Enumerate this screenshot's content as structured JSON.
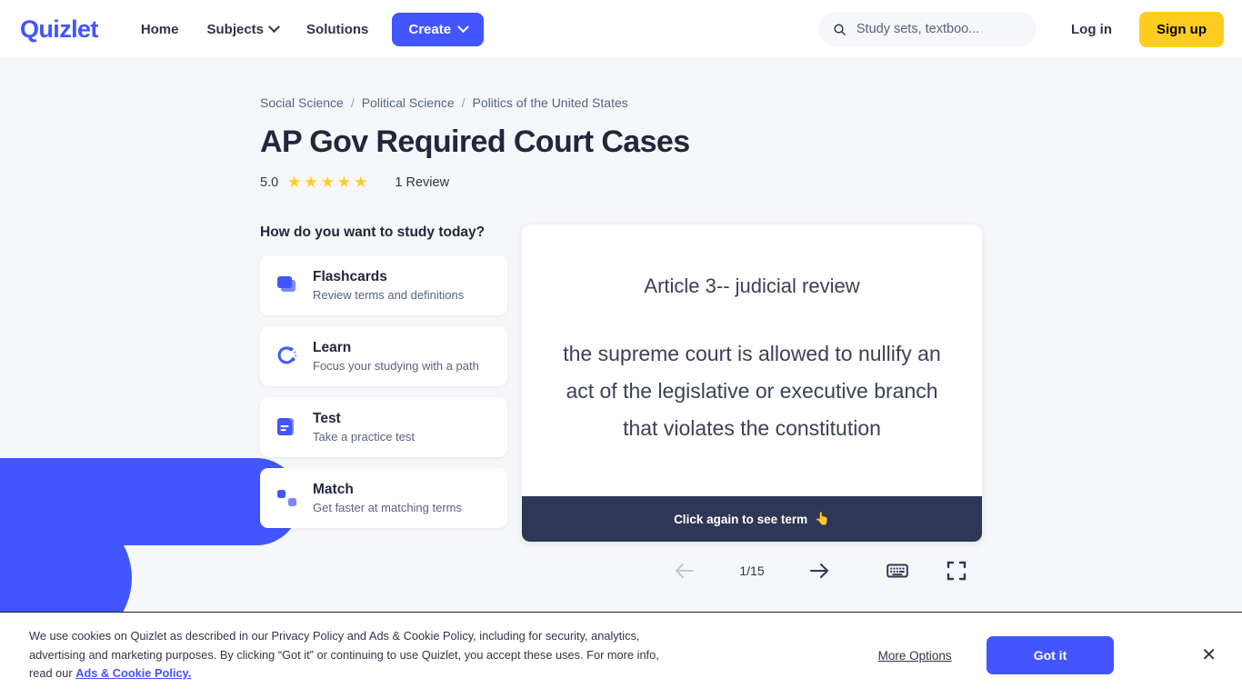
{
  "header": {
    "logo": "Quizlet",
    "nav": [
      {
        "label": "Home",
        "has_caret": false
      },
      {
        "label": "Subjects",
        "has_caret": true
      },
      {
        "label": "Solutions",
        "has_caret": false
      }
    ],
    "create_label": "Create",
    "search": {
      "placeholder": "Study sets, textboo...",
      "value": "",
      "icon": "search-icon"
    },
    "login_label": "Log in",
    "signup_label": "Sign up"
  },
  "breadcrumb": [
    "Social Science",
    "Political Science",
    "Politics of the United States"
  ],
  "breadcrumb_separator": "/",
  "page": {
    "title": "AP Gov Required Court Cases",
    "rating_value": "5.0",
    "stars": 5,
    "star_glyph": "★",
    "review_count": "1 Review"
  },
  "study": {
    "heading": "How do you want to study today?",
    "modes": [
      {
        "title": "Flashcards",
        "subtitle": "Review terms and definitions",
        "icon": "flashcards-icon"
      },
      {
        "title": "Learn",
        "subtitle": "Focus your studying with a path",
        "icon": "learn-icon"
      },
      {
        "title": "Test",
        "subtitle": "Take a practice test",
        "icon": "test-icon"
      },
      {
        "title": "Match",
        "subtitle": "Get faster at matching terms",
        "icon": "match-icon"
      }
    ]
  },
  "flashcard": {
    "term": "Article 3-- judicial review",
    "definition": "the supreme court is allowed to nullify an act of the legislative or executive branch that violates the constitution",
    "footer_text": "Click again to see term",
    "footer_emoji": "👆",
    "counter": "1/15",
    "prev_icon": "arrow-left-icon",
    "next_icon": "arrow-right-icon",
    "keyboard_icon": "keyboard-icon",
    "fullscreen_icon": "fullscreen-icon"
  },
  "cookie_banner": {
    "text_part1": "We use cookies on Quizlet as described in our Privacy Policy and Ads & Cookie Policy, including for security, analytics, advertising and marketing purposes. By clicking “Got it” or continuing to use Quizlet, you accept these uses. For more info, read our ",
    "link_label": "Ads & Cookie Policy.",
    "more_options_label": "More Options",
    "got_it_label": "Got it",
    "close_glyph": "✕"
  },
  "colors": {
    "brand_blue": "#4255ff",
    "accent_yellow": "#ffcd1f",
    "dark_navy": "#2e3856",
    "page_bg": "#f6f7fb",
    "text_primary": "#22273b",
    "text_secondary": "#586380"
  }
}
